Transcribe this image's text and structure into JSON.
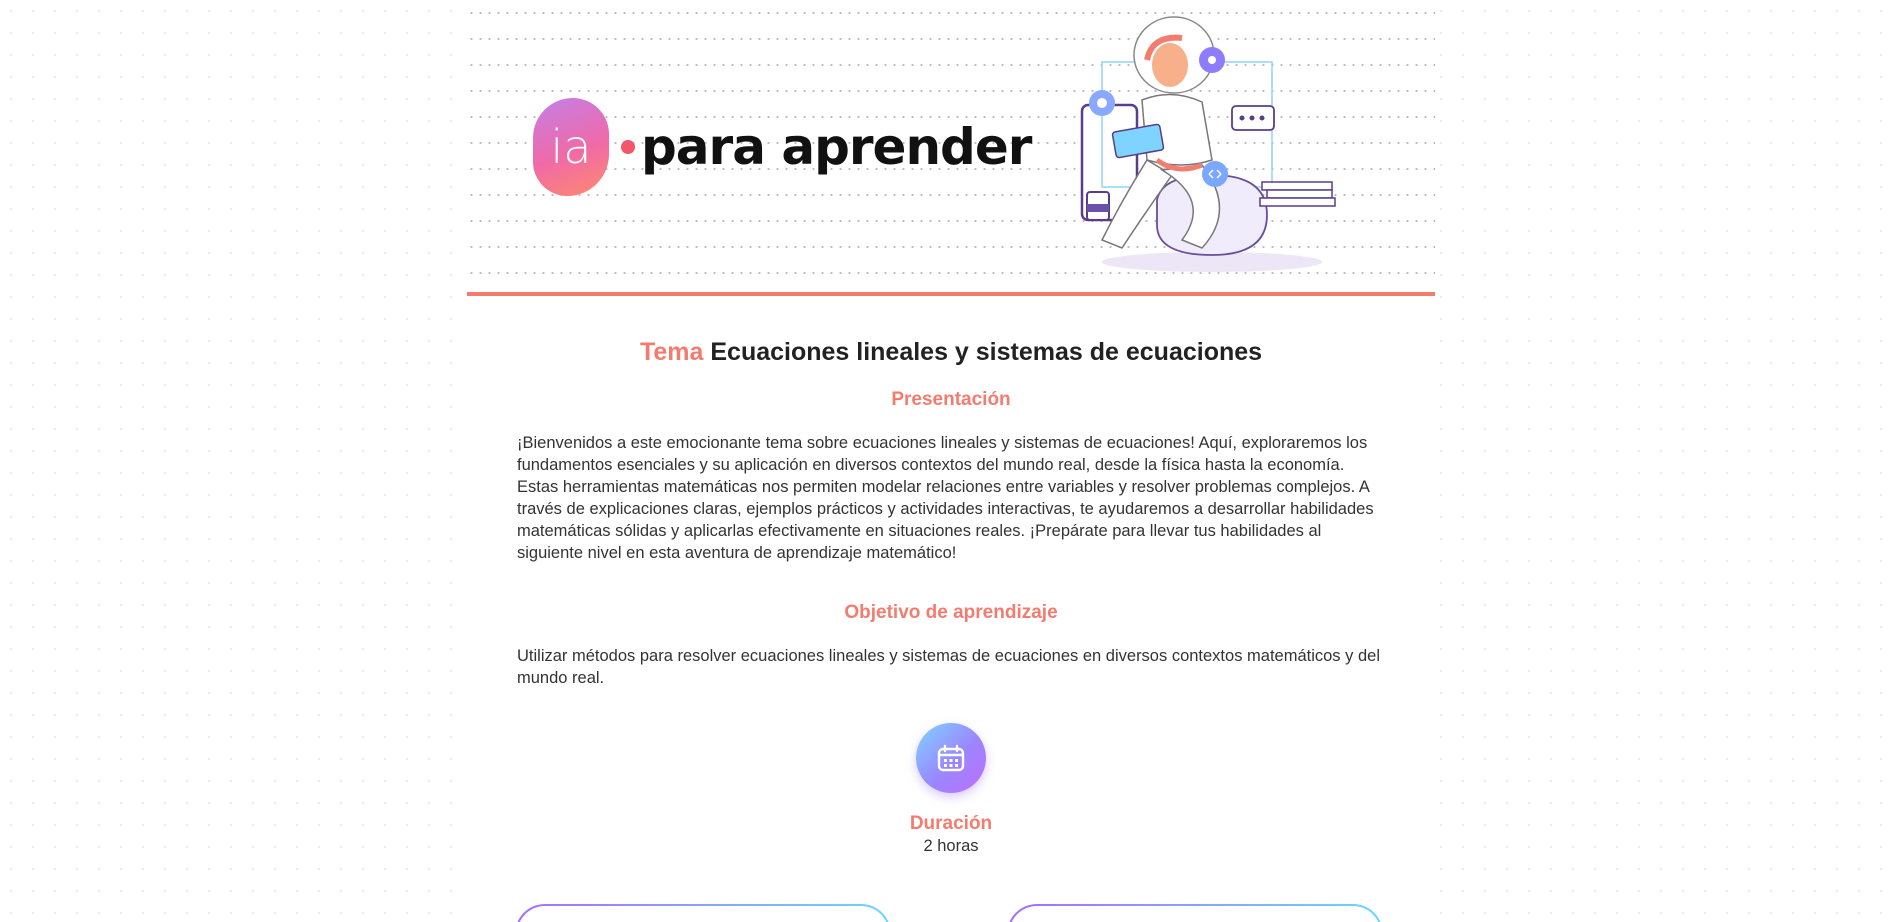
{
  "brand": {
    "logo_mark": "ia",
    "name": "para aprender"
  },
  "topic": {
    "prefix": "Tema",
    "title": "Ecuaciones lineales y sistemas de ecuaciones"
  },
  "presentation": {
    "heading": "Presentación",
    "text": "¡Bienvenidos a este emocionante tema sobre ecuaciones lineales y sistemas de ecuaciones! Aquí, exploraremos los fundamentos esenciales y su aplicación en diversos contextos del mundo real, desde la física hasta la economía. Estas herramientas matemáticas nos permiten modelar relaciones entre variables y resolver problemas complejos. A través de explicaciones claras, ejemplos prácticos y actividades interactivas, te ayudaremos a desarrollar habilidades matemáticas sólidas y aplicarlas efectivamente en situaciones reales. ¡Prepárate para llevar tus habilidades al siguiente nivel en esta aventura de aprendizaje matemático!"
  },
  "objective": {
    "heading": "Objetivo de aprendizaje",
    "text": "Utilizar métodos para resolver ecuaciones lineales y sistemas de ecuaciones en diversos contextos matemáticos y del mundo real."
  },
  "duration": {
    "icon": "calendar-icon",
    "label": "Duración",
    "value": "2 horas"
  },
  "colors": {
    "accent": "#f47c6f",
    "gradient_start": "#7fd4ff",
    "gradient_end": "#c06dff"
  }
}
